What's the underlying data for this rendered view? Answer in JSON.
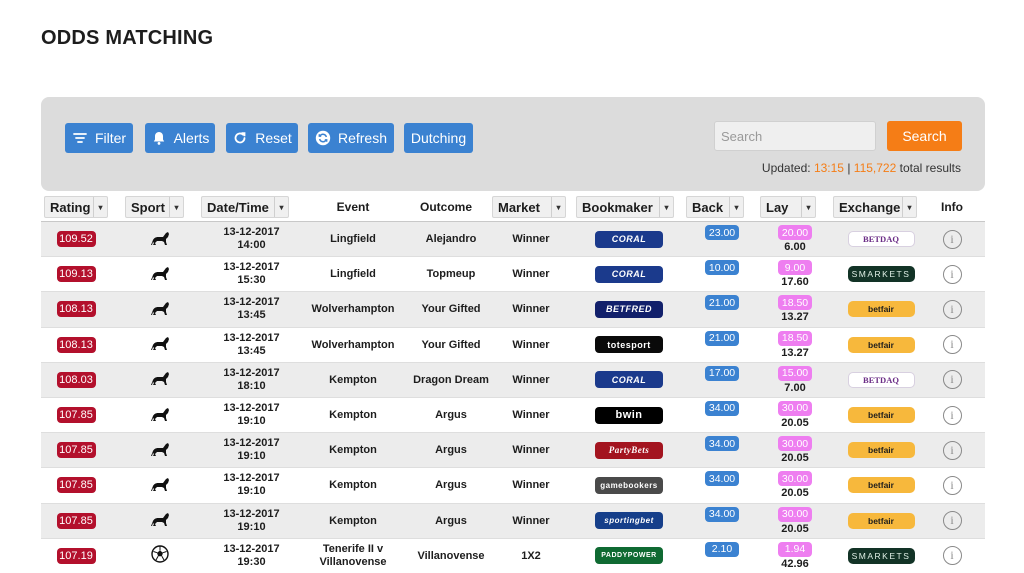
{
  "page": {
    "title": "ODDS MATCHING"
  },
  "toolbar": {
    "filter_label": "Filter",
    "alerts_label": "Alerts",
    "reset_label": "Reset",
    "refresh_label": "Refresh",
    "dutching_label": "Dutching",
    "search_placeholder": "Search",
    "search_button": "Search",
    "updated_prefix": "Updated:",
    "updated_time": "13:15",
    "separator": "|",
    "total_count": "115,722",
    "total_suffix": "total results"
  },
  "table": {
    "headers": {
      "rating": "Rating",
      "sport": "Sport",
      "datetime": "Date/Time",
      "event": "Event",
      "outcome": "Outcome",
      "market": "Market",
      "bookmaker": "Bookmaker",
      "back": "Back",
      "lay": "Lay",
      "exchange": "Exchange",
      "info": "Info"
    },
    "rows": [
      {
        "rating": "109.52",
        "sport": "horse-racing-icon",
        "date": "13-12-2017",
        "time": "14:00",
        "event": "Lingfield",
        "event2": "",
        "outcome": "Alejandro",
        "market": "Winner",
        "bookmaker": "CORAL",
        "back": "23.00",
        "lay": "20.00",
        "lay_liability": "6.00",
        "exchange": "BETDAQ"
      },
      {
        "rating": "109.13",
        "sport": "horse-racing-icon",
        "date": "13-12-2017",
        "time": "15:30",
        "event": "Lingfield",
        "event2": "",
        "outcome": "Topmeup",
        "market": "Winner",
        "bookmaker": "CORAL",
        "back": "10.00",
        "lay": "9.00",
        "lay_liability": "17.60",
        "exchange": "SMARKETS"
      },
      {
        "rating": "108.13",
        "sport": "horse-racing-icon",
        "date": "13-12-2017",
        "time": "13:45",
        "event": "Wolverhampton",
        "event2": "",
        "outcome": "Your Gifted",
        "market": "Winner",
        "bookmaker": "BETFRED",
        "back": "21.00",
        "lay": "18.50",
        "lay_liability": "13.27",
        "exchange": "betfair"
      },
      {
        "rating": "108.13",
        "sport": "horse-racing-icon",
        "date": "13-12-2017",
        "time": "13:45",
        "event": "Wolverhampton",
        "event2": "",
        "outcome": "Your Gifted",
        "market": "Winner",
        "bookmaker": "totesport",
        "back": "21.00",
        "lay": "18.50",
        "lay_liability": "13.27",
        "exchange": "betfair"
      },
      {
        "rating": "108.03",
        "sport": "horse-racing-icon",
        "date": "13-12-2017",
        "time": "18:10",
        "event": "Kempton",
        "event2": "",
        "outcome": "Dragon Dream",
        "market": "Winner",
        "bookmaker": "CORAL",
        "back": "17.00",
        "lay": "15.00",
        "lay_liability": "7.00",
        "exchange": "BETDAQ"
      },
      {
        "rating": "107.85",
        "sport": "horse-racing-icon",
        "date": "13-12-2017",
        "time": "19:10",
        "event": "Kempton",
        "event2": "",
        "outcome": "Argus",
        "market": "Winner",
        "bookmaker": "bwin",
        "back": "34.00",
        "lay": "30.00",
        "lay_liability": "20.05",
        "exchange": "betfair"
      },
      {
        "rating": "107.85",
        "sport": "horse-racing-icon",
        "date": "13-12-2017",
        "time": "19:10",
        "event": "Kempton",
        "event2": "",
        "outcome": "Argus",
        "market": "Winner",
        "bookmaker": "PartyBets",
        "back": "34.00",
        "lay": "30.00",
        "lay_liability": "20.05",
        "exchange": "betfair"
      },
      {
        "rating": "107.85",
        "sport": "horse-racing-icon",
        "date": "13-12-2017",
        "time": "19:10",
        "event": "Kempton",
        "event2": "",
        "outcome": "Argus",
        "market": "Winner",
        "bookmaker": "gamebookers",
        "back": "34.00",
        "lay": "30.00",
        "lay_liability": "20.05",
        "exchange": "betfair"
      },
      {
        "rating": "107.85",
        "sport": "horse-racing-icon",
        "date": "13-12-2017",
        "time": "19:10",
        "event": "Kempton",
        "event2": "",
        "outcome": "Argus",
        "market": "Winner",
        "bookmaker": "sportingbet",
        "back": "34.00",
        "lay": "30.00",
        "lay_liability": "20.05",
        "exchange": "betfair"
      },
      {
        "rating": "107.19",
        "sport": "football-icon",
        "date": "13-12-2017",
        "time": "19:30",
        "event": "Tenerife II v",
        "event2": "Villanovense",
        "outcome": "Villanovense",
        "market": "1X2",
        "bookmaker": "PADDYPOWER",
        "back": "2.10",
        "lay": "1.94",
        "lay_liability": "42.96",
        "exchange": "SMARKETS"
      }
    ]
  },
  "colors": {
    "primary_blue": "#3b82d1",
    "accent_orange": "#f57d16",
    "rating_red": "#b3102c",
    "lay_pink": "#ee7ef0"
  }
}
